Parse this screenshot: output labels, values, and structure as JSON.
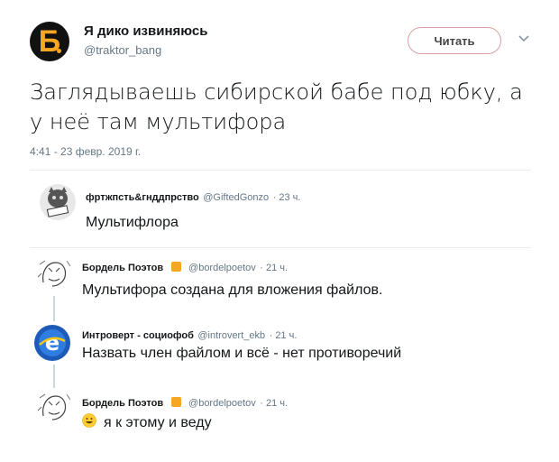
{
  "tweet": {
    "author_name": "Я дико извиняюсь",
    "author_handle": "@traktor_bang",
    "avatar_letter": "Б",
    "follow_label": "Читать",
    "text_line1": "Заглядываешь сибирской бабе под юбку, а",
    "text_line2": "у неё там мультифора",
    "timestamp": "4:41 - 23 февр. 2019 г."
  },
  "replies": [
    {
      "name": "фртжпсть&гнддпрство",
      "handle": "@GiftedGonzo",
      "time": "· 23 ч.",
      "text": "Мультифлора",
      "avatar_label": "GEAR"
    },
    {
      "name": "Бордель Поэтов",
      "handle": "@bordelpoetov",
      "time": "· 21 ч.",
      "text": "Мультифора создана для вложения файлов."
    },
    {
      "name": "Интроверт - социофоб",
      "handle": "@introvert_ekb",
      "time": "· 21 ч.",
      "text": "Назвать член файлом и всё - нет противоречий"
    },
    {
      "name": "Бордель Поэтов",
      "handle": "@bordelpoetov",
      "time": "· 21 ч.",
      "text": "я к этому и веду"
    }
  ],
  "colors": {
    "accent": "#f5a623",
    "text": "#14171a",
    "muted": "#657786",
    "divider": "#e6ecf0"
  }
}
